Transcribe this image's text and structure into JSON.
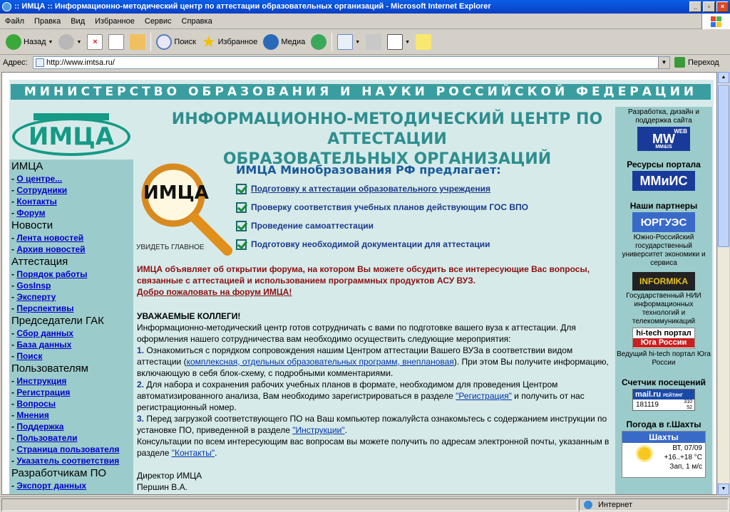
{
  "window": {
    "title": ":: ИМЦА :: Информационно-методический центр по аттестации образовательных организаций - Microsoft Internet Explorer"
  },
  "menu": [
    "Файл",
    "Правка",
    "Вид",
    "Избранное",
    "Сервис",
    "Справка"
  ],
  "toolbar": {
    "back": "Назад",
    "search": "Поиск",
    "favorites": "Избранное",
    "media": "Медиа"
  },
  "address": {
    "label": "Адрес:",
    "url": "http://www.imtsa.ru/",
    "go": "Переход"
  },
  "status": {
    "zone": "Интернет"
  },
  "page": {
    "banner": "МИНИСТЕРСТВО ОБРАЗОВАНИЯ И НАУКИ РОССИЙСКОЙ ФЕДЕРАЦИИ",
    "logo": "ИМЦА",
    "headline1": "ИНФОРМАЦИОННО-МЕТОДИЧЕСКИЙ ЦЕНТР ПО АТТЕСТАЦИИ",
    "headline2": "ОБРАЗОВАТЕЛЬНЫХ ОРГАНИЗАЦИЙ",
    "magnifier_logo": "ИМЦА",
    "magnifier_caption": "УВИДЕТЬ ГЛАВНОЕ",
    "offer_title": "ИМЦА Минобразования РФ предлагает:",
    "offers": [
      "Подготовку к аттестации образовательного учреждения",
      "Проверку соответствия учебных планов действующим ГОС ВПО",
      "Проведение самоаттестации",
      "Подготовку необходимой документации для аттестации"
    ],
    "forum_text": "ИМЦА объявляет об открытии форума, на котором Вы можете обсудить все интересующие Вас вопросы, связанные с аттестацией и использованием программных продуктов АСУ ВУЗ.",
    "forum_link": "Добро пожаловать на форум ИМЦА!",
    "greeting": "УВАЖАЕМЫЕ КОЛЛЕГИ!",
    "intro": "Информационно-методический центр готов сотрудничать с вами по подготовке вашего вуза к аттестации. Для оформления нашего сотрудничества вам необходимо осуществить следующие мероприятия:",
    "step1_num": "1.",
    "step1_a": " Ознакомиться с порядком сопровождения нашим Центром аттестации Вашего ВУЗа в соответствии видом аттестации (",
    "step1_link": "комплексная, отдельных образовательных программ, внеплановая",
    "step1_b": "). При этом Вы получите информацию, включающую в себя блок-схему, с подробными комментариями.",
    "step2_num": "2.",
    "step2_a": " Для набора и сохранения рабочих учебных планов в формате, необходимом для проведения Центром автоматизированного анализа, Вам необходимо зарегистрироваться в разделе ",
    "step2_link": "\"Регистрация\"",
    "step2_b": "  и получить от нас регистрационный номер.",
    "step3_num": "3.",
    "step3_a": " Перед загрузкой соответствующего ПО на Ваш компьютер пожалуйста ознакомьтесь с содержанием инструкции по установке ПО, приведенной в разделе ",
    "step3_link": "\"Инструкции\"",
    "step3_b": ".",
    "consult_a": "Консультации по всем интересующим вас вопросам вы можете получить по адресам электронной почты, указанным в разделе ",
    "consult_link": "\"Контакты\"",
    "consult_b": ".",
    "sign1": "Директор ИМЦА",
    "sign2": "Першин В.А."
  },
  "nav": [
    {
      "head": "ИМЦА",
      "items": [
        "О центре...",
        "Сотрудники",
        "Контакты",
        "Форум"
      ]
    },
    {
      "head": "Новости",
      "items": [
        "Лента новостей",
        "Архив новостей"
      ]
    },
    {
      "head": "Аттестация",
      "items": [
        "Порядок работы",
        "GosInsp",
        "Эксперту",
        "Перспективы"
      ]
    },
    {
      "head": "Председатели ГАК",
      "items": [
        "Сбор данных",
        "База данных",
        "Поиск"
      ]
    },
    {
      "head": "Пользователям",
      "items": [
        "Инструкция",
        "Регистрация",
        "Вопросы",
        "Мнения",
        "Поддержка",
        "Пользователи",
        "Страница пользователя",
        "Указатель соответствия"
      ]
    },
    {
      "head": "Разработчикам ПО",
      "items": [
        "Экспорт данных"
      ]
    }
  ],
  "right": {
    "dev_caption": "Разработка, дизайн и поддержка сайта",
    "mw_top": "WEB",
    "mw_logo": "MW",
    "mw_sub": "MM&IS",
    "resources": "Ресурсы портала",
    "mmis": "ММиИС",
    "partners": "Наши партнеры",
    "urgues": "ЮРГУЭС",
    "urgues_desc": "Южно-Российский государственный университет экономики и сервиса",
    "informika": "INFORMIKA",
    "informika_desc": "Государственный НИИ информационных технологий и телекоммуникаций",
    "hitech1": "hi-tech портал",
    "hitech2": "Юга России",
    "hitech_desc": "Ведущий hi-tech портал Юга России",
    "counter": "Счетчик посещений",
    "mail": "mail.ru",
    "mail_tag": "РЕЙТИНГ",
    "count1": "181119",
    "count2": "310",
    "count3": "52",
    "weather_title": "Погода в г.Шахты",
    "city": "Шахты",
    "date": "ВТ, 07/09",
    "temp": "+16..+18 °C",
    "wind": "Зап, 1 м/с"
  },
  "colors": {
    "banner": "#3a9ea0",
    "nav": "#9ccbcb",
    "headline": "#2f8e8e",
    "forum": "#8b1010"
  }
}
